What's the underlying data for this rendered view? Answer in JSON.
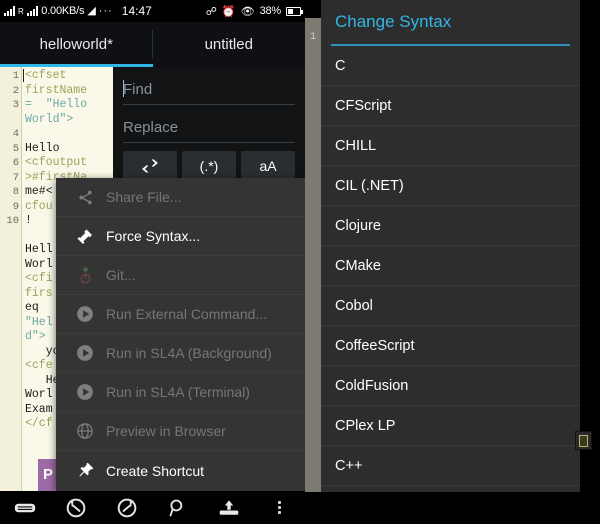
{
  "statusbar": {
    "network_speed": "0.00KB/s",
    "roaming_label": "R",
    "wifi_icon": "wifi-icon",
    "more_dots": "···",
    "clock": "14:47",
    "bluetooth_icon": "bluetooth-icon",
    "alarm_icon": "alarm-icon",
    "eye_icon": "eye-icon",
    "battery_percent": "38%",
    "battery_icon": "battery-icon"
  },
  "tabs": [
    {
      "label": "helloworld*",
      "active": true
    },
    {
      "label": "untitled",
      "active": false
    }
  ],
  "editor": {
    "line_numbers": [
      "1",
      "2",
      "3",
      "",
      "4",
      "5",
      "6",
      "7",
      "8",
      "9",
      "10"
    ],
    "code_lines": [
      {
        "text": "<cfset",
        "type": "tag"
      },
      {
        "text": "firstName",
        "type": "tag"
      },
      {
        "text": "=  \"Hello",
        "type": "str"
      },
      {
        "text": "World\">",
        "type": "str"
      },
      {
        "text": "",
        "type": "plain"
      },
      {
        "text": "Hello",
        "type": "plain"
      },
      {
        "text": "<cfoutput",
        "type": "tag"
      },
      {
        "text": ">#firstNa",
        "type": "tag"
      },
      {
        "text": "me#<",
        "type": "plain"
      },
      {
        "text": "cfou",
        "type": "tag"
      },
      {
        "text": "!",
        "type": "plain"
      },
      {
        "text": "",
        "type": "plain"
      },
      {
        "text": "Hell",
        "type": "plain"
      },
      {
        "text": "Worl",
        "type": "plain"
      },
      {
        "text": "<cfi",
        "type": "tag"
      },
      {
        "text": "firs",
        "type": "tag"
      },
      {
        "text": "eq",
        "type": "plain"
      },
      {
        "text": "\"Hel",
        "type": "str"
      },
      {
        "text": "d\">",
        "type": "str"
      },
      {
        "text": "   yo",
        "type": "plain"
      },
      {
        "text": "<cfe",
        "type": "tag"
      },
      {
        "text": "   He",
        "type": "plain"
      },
      {
        "text": "Worl",
        "type": "plain"
      },
      {
        "text": "Exam",
        "type": "plain"
      },
      {
        "text": "</cf",
        "type": "tag"
      }
    ],
    "purple_letter": "P"
  },
  "find_panel": {
    "find_placeholder": "Find",
    "replace_placeholder": "Replace",
    "find_value": "",
    "replace_value": "",
    "buttons": [
      {
        "label": "⇄",
        "name": "replace-all-button"
      },
      {
        "label": "(.*)",
        "name": "regex-toggle-button"
      },
      {
        "label": "aA",
        "name": "case-sensitive-button"
      }
    ]
  },
  "context_menu": {
    "items": [
      {
        "label": "Share File...",
        "icon": "share-icon",
        "disabled": true
      },
      {
        "label": "Force Syntax...",
        "icon": "hammer-icon",
        "disabled": false
      },
      {
        "label": "Git...",
        "icon": "git-icon",
        "disabled": true
      },
      {
        "label": "Run External Command...",
        "icon": "play-icon",
        "disabled": true
      },
      {
        "label": "Run in SL4A (Background)",
        "icon": "play-icon",
        "disabled": true
      },
      {
        "label": "Run in SL4A (Terminal)",
        "icon": "play-icon",
        "disabled": true
      },
      {
        "label": "Preview in Browser",
        "icon": "globe-icon",
        "disabled": true
      },
      {
        "label": "Create Shortcut",
        "icon": "pin-icon",
        "disabled": false
      }
    ]
  },
  "syntax_dialog": {
    "title": "Change Syntax",
    "options": [
      "C",
      "CFScript",
      "CHILL",
      "CIL (.NET)",
      "Clojure",
      "CMake",
      "Cobol",
      "CoffeeScript",
      "ColdFusion",
      "CPlex LP",
      "C++"
    ]
  },
  "bottom_nav": [
    {
      "name": "keyboard-icon"
    },
    {
      "name": "undo-icon"
    },
    {
      "name": "redo-icon"
    },
    {
      "name": "search-icon"
    },
    {
      "name": "save-icon"
    },
    {
      "name": "overflow-menu-icon"
    }
  ],
  "colors": {
    "accent": "#33b5e5",
    "editor_bg": "#faf8e8",
    "menu_bg": "#343434",
    "dialog_bg": "#2d2d2d",
    "purple": "#9d6aa5"
  }
}
